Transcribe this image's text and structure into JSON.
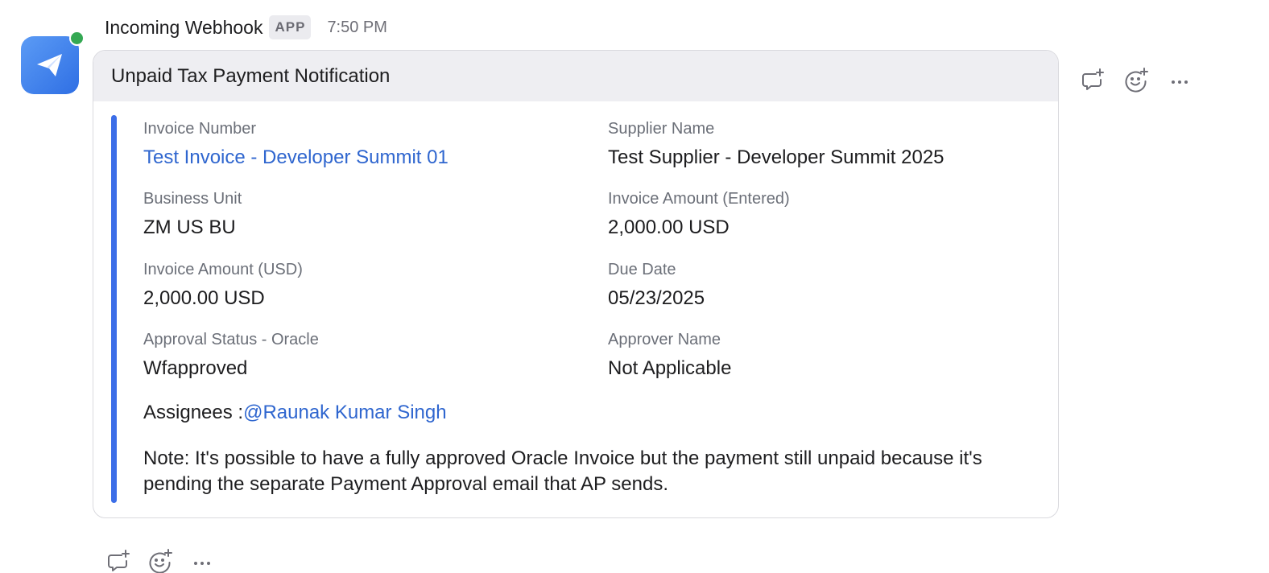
{
  "message": {
    "sender": "Incoming Webhook",
    "badge": "APP",
    "time": "7:50 PM",
    "avatar_icon": "paper-plane-icon",
    "presence": "online"
  },
  "card": {
    "title": "Unpaid Tax Payment Notification",
    "accent_color": "#3c6ee8",
    "fields": [
      {
        "label": "Invoice Number",
        "value": "Test Invoice - Developer Summit 01",
        "link": true
      },
      {
        "label": "Supplier Name",
        "value": "Test Supplier - Developer Summit 2025"
      },
      {
        "label": "Business Unit",
        "value": "ZM US BU"
      },
      {
        "label": "Invoice Amount (Entered)",
        "value": "2,000.00 USD"
      },
      {
        "label": "Invoice Amount (USD)",
        "value": "2,000.00 USD"
      },
      {
        "label": "Due Date",
        "value": "05/23/2025"
      },
      {
        "label": "Approval Status - Oracle",
        "value": "Wfapproved"
      },
      {
        "label": "Approver Name",
        "value": "Not Applicable"
      }
    ],
    "assignees_label": "Assignees :",
    "assignee_mention": "@Raunak Kumar Singh",
    "note": "Note: It's possible to have a fully approved Oracle Invoice but the payment still unpaid because it's pending the separate Payment Approval email that AP sends."
  },
  "actions": {
    "icons": [
      "reply-thread-icon",
      "add-reaction-icon",
      "more-options-icon"
    ]
  }
}
